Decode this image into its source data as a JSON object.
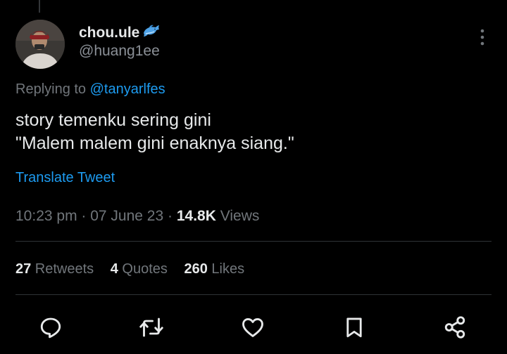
{
  "tweet": {
    "author": {
      "display_name": "chou.ule",
      "name_emoji": "dolphin-icon",
      "handle": "@huang1ee"
    },
    "replying_prefix": "Replying to ",
    "replying_to": "@tanyarlfes",
    "text_lines": [
      "story temenku sering gini",
      "\"Malem malem gini enaknya siang.\""
    ],
    "translate_label": "Translate Tweet",
    "time": "10:23 pm",
    "date": "07 June 23",
    "separator": " · ",
    "views_count": "14.8K",
    "views_label": " Views",
    "stats": {
      "retweets_count": "27",
      "retweets_label": " Retweets",
      "quotes_count": "4",
      "quotes_label": " Quotes",
      "likes_count": "260",
      "likes_label": " Likes"
    }
  },
  "actions": [
    "reply-icon",
    "retweet-icon",
    "like-icon",
    "bookmark-icon",
    "share-icon"
  ],
  "colors": {
    "background": "#000000",
    "primary_text": "#e7e9ea",
    "secondary_text": "#71767b",
    "accent_blue": "#1d9bf0",
    "divider": "#2f3336"
  }
}
